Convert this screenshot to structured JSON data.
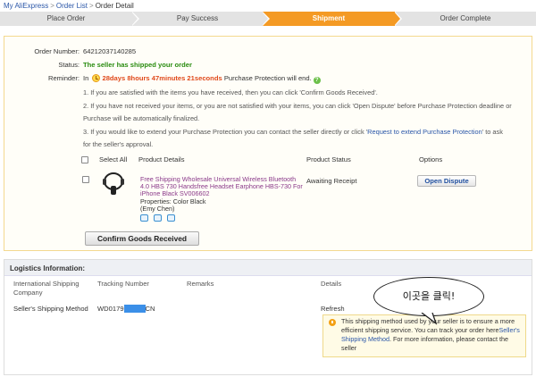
{
  "breadcrumb": {
    "root": "My AliExpress",
    "list": "Order List",
    "current": "Order Detail",
    "sep": ">"
  },
  "steps": [
    {
      "label": "Place Order",
      "active": false
    },
    {
      "label": "Pay Success",
      "active": false
    },
    {
      "label": "Shipment",
      "active": true
    },
    {
      "label": "Order Complete",
      "active": false
    }
  ],
  "order": {
    "number_label": "Order Number:",
    "number": "64212037140285",
    "status_label": "Status:",
    "status": "The seller has shipped your order",
    "reminder_label": "Reminder:",
    "reminder_in": "In",
    "countdown": "28days 8hours 47minutes 21seconds",
    "reminder_suffix": "Purchase Protection will end.",
    "notes": [
      "1. If you are satisfied with the items you have received, then you can click 'Confirm Goods Received'.",
      "2. If you have not received your items, or you are not satisfied with your items, you can click 'Open Dispute' before Purchase Protection deadline or",
      "Purchase will be automatically finalized.",
      "3. If you would like to extend your Purchase Protection you can contact the seller directly or click '",
      "Request to extend Purchase Protection",
      "' to ask",
      "for the seller's approval."
    ],
    "columns": {
      "select_all": "Select All",
      "product_details": "Product Details",
      "product_status": "Product Status",
      "options": "Options"
    },
    "product": {
      "title": "Free Shipping Wholesale Universal Wireless Bluetooth 4.0 HBS 730 Handsfree Headset Earphone HBS-730 For iPhone Black SV006602",
      "properties": "Properties: Color Black",
      "buyer": "(Emy Chen)",
      "status": "Awaiting Receipt",
      "dispute_button": "Open Dispute"
    },
    "confirm_button": "Confirm Goods Received"
  },
  "logistics": {
    "title": "Logistics Information:",
    "col_company": "International Shipping Company",
    "col_tracking": "Tracking Number",
    "col_remarks": "Remarks",
    "col_details": "Details",
    "company": "Seller's Shipping Method",
    "tracking_prefix": "WD0179",
    "tracking_suffix": "CN",
    "refresh": "Refresh",
    "info_text_1": "This shipping method used by your seller is to ensure a more efficient shipping service. You can track your order here",
    "info_link": "Seller's Shipping Method",
    "info_text_2": ". For more information, please contact the seller"
  },
  "bubble_text": "이곳을 클릭!",
  "colors": {
    "accent": "#f49a24",
    "link": "#2a56a8",
    "green": "#2a8c10",
    "countdown": "#e0491a"
  },
  "icons": [
    "clock-icon",
    "help-icon",
    "headset-thumbnail",
    "warning-icon"
  ]
}
